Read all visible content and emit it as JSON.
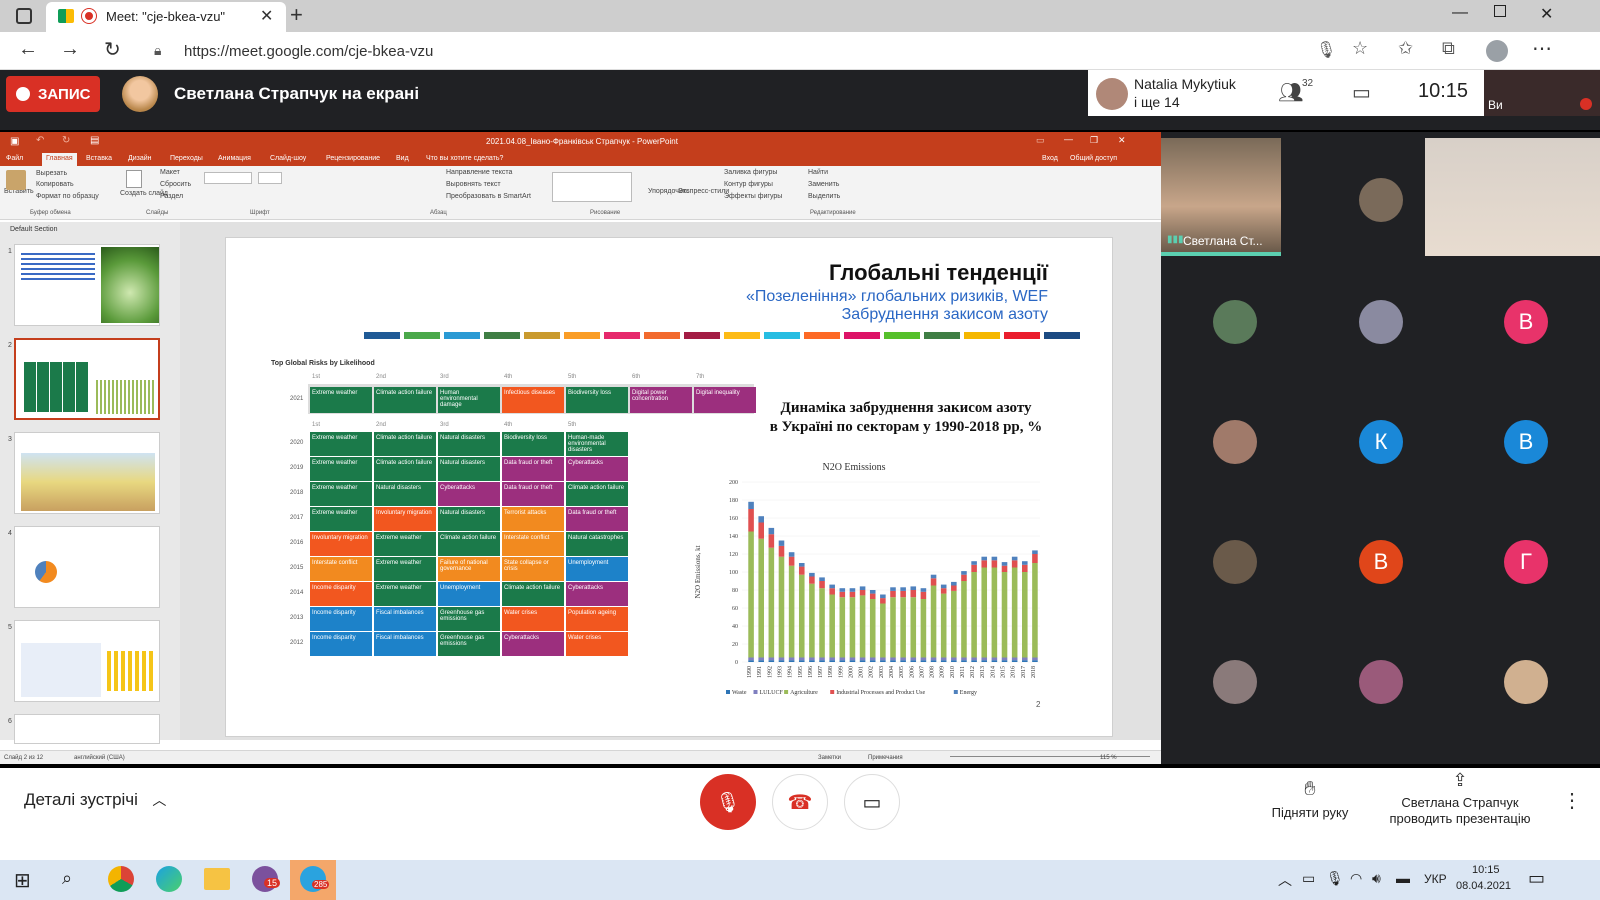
{
  "browser": {
    "tab_title": "Meet: \"cje-bkea-vzu\"",
    "url": "https://meet.google.com/cje-bkea-vzu"
  },
  "meet": {
    "record_label": "ЗАПИС",
    "presenter_title": "Светлана Страпчук на екрані",
    "pinned_name": "Natalia Mykytiuk",
    "pinned_sub": "і ще 14",
    "participants_count": "32",
    "time": "10:15",
    "self_label": "Ви",
    "details_label": "Деталі зустрічі",
    "raise_hand": "Підняти руку",
    "presenting": "Светлана Страпчук проводить презентацію",
    "speaker_label": "Светлана Ст..."
  },
  "ppt": {
    "doc_title": "2021.04.08_Івано-Франківськ Страпчук - PowerPoint",
    "menu": [
      "Файл",
      "Главная",
      "Вставка",
      "Дизайн",
      "Переходы",
      "Анимация",
      "Слайд-шоу",
      "Рецензирование",
      "Вид",
      "Что вы хотите сделать?"
    ],
    "menu_right": [
      "Вход",
      "Общий доступ"
    ],
    "ribbon_groups": [
      "Буфер обмена",
      "Слайды",
      "Шрифт",
      "Абзац",
      "Рисование",
      "Редактирование"
    ],
    "ribbon_items": {
      "paste": "Вставить",
      "cut": "Вырезать",
      "copy": "Копировать",
      "format": "Формат по образцу",
      "create": "Создать слайд",
      "layout": "Макет",
      "reset": "Сбросить",
      "section": "Раздел",
      "find": "Найти",
      "replace": "Заменить",
      "select": "Выделить",
      "arrange": "Упорядочить",
      "quick": "Экспресс-стили",
      "fill": "Заливка фигуры",
      "outline": "Контур фигуры",
      "effects": "Эффекты фигуры",
      "text_dir": "Направление текста",
      "align_text": "Выровнять текст",
      "smartart": "Преобразовать в SmartArt"
    },
    "section_name": "Default Section",
    "status_left": "Слайд 2 из 12",
    "status_lang": "английский (США)",
    "status_notes": "Заметки",
    "status_comments": "Примечания",
    "zoom": "115 %"
  },
  "slide": {
    "title": "Глобальні тенденції",
    "subtitle1": "«Позеленіння» глобальних ризиків, WEF",
    "subtitle2": "Забруднення закисом азоту",
    "risks_title": "Top Global Risks by Likelihood",
    "ranks": [
      "1st",
      "2nd",
      "3rd",
      "4th",
      "5th",
      "6th",
      "7th"
    ],
    "row2021": {
      "year": "2021",
      "cells": [
        {
          "t": "Extreme weather",
          "c": "#1b7a4a"
        },
        {
          "t": "Climate action failure",
          "c": "#1b7a4a"
        },
        {
          "t": "Human environmental damage",
          "c": "#1b7a4a"
        },
        {
          "t": "Infectious diseases",
          "c": "#f2571f"
        },
        {
          "t": "Biodiversity loss",
          "c": "#1b7a4a"
        },
        {
          "t": "Digital power concentration",
          "c": "#9c2f7e"
        },
        {
          "t": "Digital inequality",
          "c": "#9c2f7e"
        }
      ]
    },
    "rows": [
      {
        "year": "2020",
        "cells": [
          {
            "t": "Extreme weather",
            "c": "#1b7a4a"
          },
          {
            "t": "Climate action failure",
            "c": "#1b7a4a"
          },
          {
            "t": "Natural disasters",
            "c": "#1b7a4a"
          },
          {
            "t": "Biodiversity loss",
            "c": "#1b7a4a"
          },
          {
            "t": "Human-made environmental disasters",
            "c": "#1b7a4a"
          }
        ]
      },
      {
        "year": "2019",
        "cells": [
          {
            "t": "Extreme weather",
            "c": "#1b7a4a"
          },
          {
            "t": "Climate action failure",
            "c": "#1b7a4a"
          },
          {
            "t": "Natural disasters",
            "c": "#1b7a4a"
          },
          {
            "t": "Data fraud or theft",
            "c": "#9c2f7e"
          },
          {
            "t": "Cyberattacks",
            "c": "#9c2f7e"
          }
        ]
      },
      {
        "year": "2018",
        "cells": [
          {
            "t": "Extreme weather",
            "c": "#1b7a4a"
          },
          {
            "t": "Natural disasters",
            "c": "#1b7a4a"
          },
          {
            "t": "Cyberattacks",
            "c": "#9c2f7e"
          },
          {
            "t": "Data fraud or theft",
            "c": "#9c2f7e"
          },
          {
            "t": "Climate action failure",
            "c": "#1b7a4a"
          }
        ]
      },
      {
        "year": "2017",
        "cells": [
          {
            "t": "Extreme weather",
            "c": "#1b7a4a"
          },
          {
            "t": "Involuntary migration",
            "c": "#f2571f"
          },
          {
            "t": "Natural disasters",
            "c": "#1b7a4a"
          },
          {
            "t": "Terrorist attacks",
            "c": "#f28a1f"
          },
          {
            "t": "Data fraud or theft",
            "c": "#9c2f7e"
          }
        ]
      },
      {
        "year": "2016",
        "cells": [
          {
            "t": "Involuntary migration",
            "c": "#f2571f"
          },
          {
            "t": "Extreme weather",
            "c": "#1b7a4a"
          },
          {
            "t": "Climate action failure",
            "c": "#1b7a4a"
          },
          {
            "t": "Interstate conflict",
            "c": "#f28a1f"
          },
          {
            "t": "Natural catastrophes",
            "c": "#1b7a4a"
          }
        ]
      },
      {
        "year": "2015",
        "cells": [
          {
            "t": "Interstate conflict",
            "c": "#f28a1f"
          },
          {
            "t": "Extreme weather",
            "c": "#1b7a4a"
          },
          {
            "t": "Failure of national governance",
            "c": "#f28a1f"
          },
          {
            "t": "State collapse or crisis",
            "c": "#f28a1f"
          },
          {
            "t": "Unemployment",
            "c": "#1d82c9"
          }
        ]
      },
      {
        "year": "2014",
        "cells": [
          {
            "t": "Income disparity",
            "c": "#f2571f"
          },
          {
            "t": "Extreme weather",
            "c": "#1b7a4a"
          },
          {
            "t": "Unemployment",
            "c": "#1d82c9"
          },
          {
            "t": "Climate action failure",
            "c": "#1b7a4a"
          },
          {
            "t": "Cyberattacks",
            "c": "#9c2f7e"
          }
        ]
      },
      {
        "year": "2013",
        "cells": [
          {
            "t": "Income disparity",
            "c": "#1d82c9"
          },
          {
            "t": "Fiscal imbalances",
            "c": "#1d82c9"
          },
          {
            "t": "Greenhouse gas emissions",
            "c": "#1b7a4a"
          },
          {
            "t": "Water crises",
            "c": "#f2571f"
          },
          {
            "t": "Population ageing",
            "c": "#f2571f"
          }
        ]
      },
      {
        "year": "2012",
        "cells": [
          {
            "t": "Income disparity",
            "c": "#1d82c9"
          },
          {
            "t": "Fiscal imbalances",
            "c": "#1d82c9"
          },
          {
            "t": "Greenhouse gas emissions",
            "c": "#1b7a4a"
          },
          {
            "t": "Cyberattacks",
            "c": "#9c2f7e"
          },
          {
            "t": "Water crises",
            "c": "#f2571f"
          }
        ]
      }
    ],
    "dynamics_title1": "Динаміка забруднення закисом азоту",
    "dynamics_title2": "в Україні по секторам у 1990-2018 рр, %",
    "page_number": "2",
    "sdg_colors": [
      "#1f5a96",
      "#4aa84a",
      "#2a9ad4",
      "#3f7e44",
      "#c99a2e",
      "#fa9d26",
      "#e6296c",
      "#f26a2e",
      "#a31c44",
      "#fdbb16",
      "#26bde2",
      "#fd6925",
      "#dd1367",
      "#56c02b",
      "#3f7e44",
      "#f5b700",
      "#ea1d2d",
      "#1b4a82"
    ]
  },
  "chart_data": {
    "type": "bar",
    "title": "N2O Emissions",
    "xlabel": "",
    "ylabel": "N2O Emissions, kt",
    "ylim": [
      0,
      200
    ],
    "yticks": [
      0,
      20,
      40,
      60,
      80,
      100,
      120,
      140,
      160,
      180,
      200
    ],
    "stacked": true,
    "categories": [
      "1990",
      "1991",
      "1992",
      "1993",
      "1994",
      "1995",
      "1996",
      "1997",
      "1998",
      "1999",
      "2000",
      "2001",
      "2002",
      "2003",
      "2004",
      "2005",
      "2006",
      "2007",
      "2008",
      "2009",
      "2010",
      "2011",
      "2012",
      "2013",
      "2014",
      "2015",
      "2016",
      "2017",
      "2018"
    ],
    "series": [
      {
        "name": "Waste",
        "color": "#2e75b6",
        "values": [
          2,
          2,
          2,
          2,
          2,
          2,
          2,
          2,
          2,
          2,
          2,
          2,
          2,
          2,
          2,
          2,
          2,
          2,
          2,
          2,
          2,
          2,
          2,
          2,
          2,
          2,
          2,
          2,
          2
        ]
      },
      {
        "name": "LULUCF",
        "color": "#7f7fbf",
        "values": [
          3,
          3,
          3,
          3,
          3,
          3,
          3,
          3,
          3,
          3,
          3,
          3,
          3,
          3,
          3,
          3,
          3,
          3,
          3,
          3,
          3,
          3,
          3,
          3,
          3,
          3,
          3,
          3,
          3
        ]
      },
      {
        "name": "Agriculture",
        "color": "#9bbb59",
        "values": [
          140,
          132,
          122,
          112,
          102,
          92,
          82,
          77,
          70,
          67,
          67,
          69,
          65,
          60,
          67,
          67,
          67,
          65,
          80,
          71,
          74,
          85,
          95,
          100,
          100,
          95,
          100,
          95,
          105
        ]
      },
      {
        "name": "Industrial Processes and Product Use",
        "color": "#e05050",
        "values": [
          25,
          18,
          15,
          12,
          10,
          9,
          8,
          8,
          7,
          6,
          6,
          6,
          6,
          6,
          7,
          7,
          8,
          8,
          8,
          6,
          6,
          7,
          8,
          8,
          8,
          7,
          8,
          8,
          10
        ]
      },
      {
        "name": "Energy",
        "color": "#4f81bd",
        "values": [
          8,
          7,
          7,
          6,
          5,
          4,
          4,
          4,
          4,
          4,
          4,
          4,
          4,
          4,
          4,
          4,
          4,
          4,
          4,
          4,
          4,
          4,
          4,
          4,
          4,
          4,
          4,
          4,
          4
        ]
      }
    ]
  },
  "taskbar": {
    "lang": "УКР",
    "time": "10:15",
    "date": "08.04.2021",
    "badge_viber": "15",
    "badge_telegram": "285"
  },
  "participants": [
    {
      "initial": "",
      "color": "#7a6a5a"
    },
    {
      "initial": "",
      "color": "#5a7a5a"
    },
    {
      "initial": "",
      "color": "#8a8aa0"
    },
    {
      "initial": "В",
      "color": "#e8336a"
    },
    {
      "initial": "",
      "color": "#a07a6a"
    },
    {
      "initial": "К",
      "color": "#1a88d8"
    },
    {
      "initial": "В",
      "color": "#1a88d8"
    },
    {
      "initial": "",
      "color": "#6a5a4a"
    },
    {
      "initial": "В",
      "color": "#e0461a"
    },
    {
      "initial": "Г",
      "color": "#e8336a"
    },
    {
      "initial": "",
      "color": "#8a7a7a"
    },
    {
      "initial": "",
      "color": "#9a5a7a"
    },
    {
      "initial": "",
      "color": "#d0b090"
    },
    {
      "initial": "",
      "color": "#7a6a8a"
    }
  ]
}
